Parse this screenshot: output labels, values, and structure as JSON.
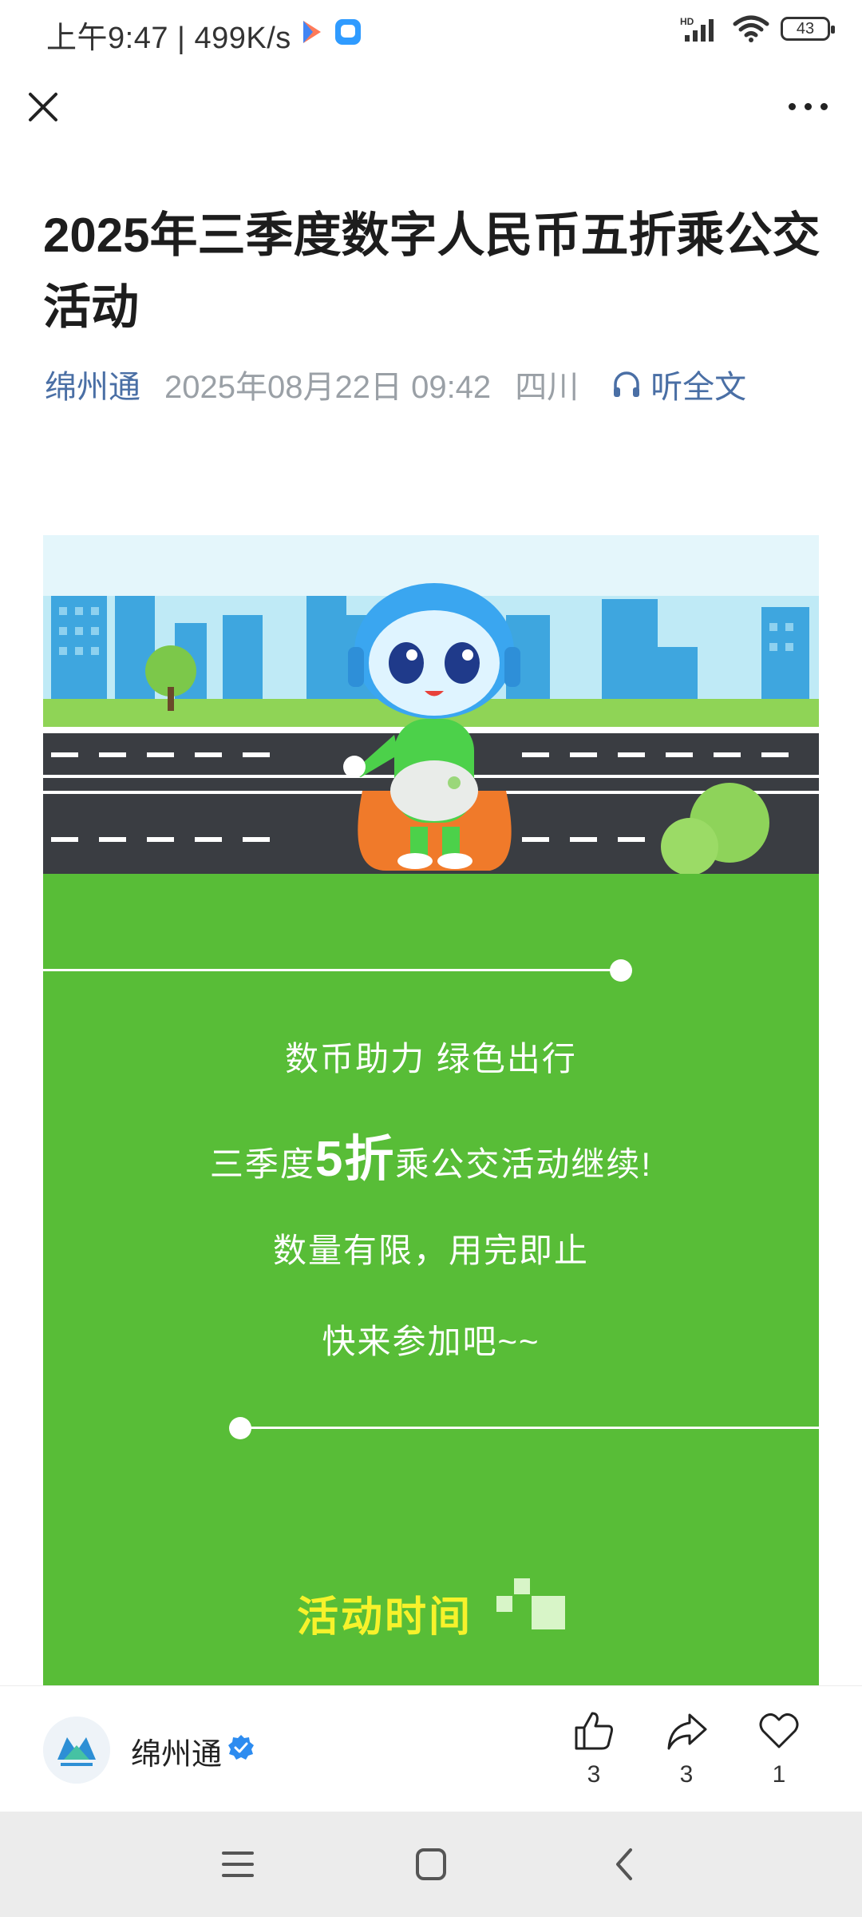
{
  "status": {
    "time": "上午9:47",
    "speed": "499K/s",
    "battery": "43",
    "network": "HD"
  },
  "nav": {
    "close_icon": "close-icon",
    "more_icon": "more-icon"
  },
  "article": {
    "title": "2025年三季度数字人民币五折乘公交活动",
    "author": "绵州通",
    "date": "2025年08月22日 09:42",
    "region": "四川",
    "listen_label": "听全文"
  },
  "banner": {
    "line1": "数币助力 绿色出行",
    "line2_prefix": "三季度",
    "line2_big": "5折",
    "line2_suffix": "乘公交活动继续!",
    "line3": "数量有限，用完即止",
    "line4": "快来参加吧~~",
    "section_title": "活动时间",
    "colors": {
      "green": "#58bd37",
      "title_yellow": "#f7f22b",
      "road": "#3a3d42",
      "sky": "#bfeaf6"
    }
  },
  "footer": {
    "account_name": "绵州通",
    "verified_icon": "verified-icon",
    "likes": "3",
    "shares": "3",
    "favorites": "1"
  }
}
